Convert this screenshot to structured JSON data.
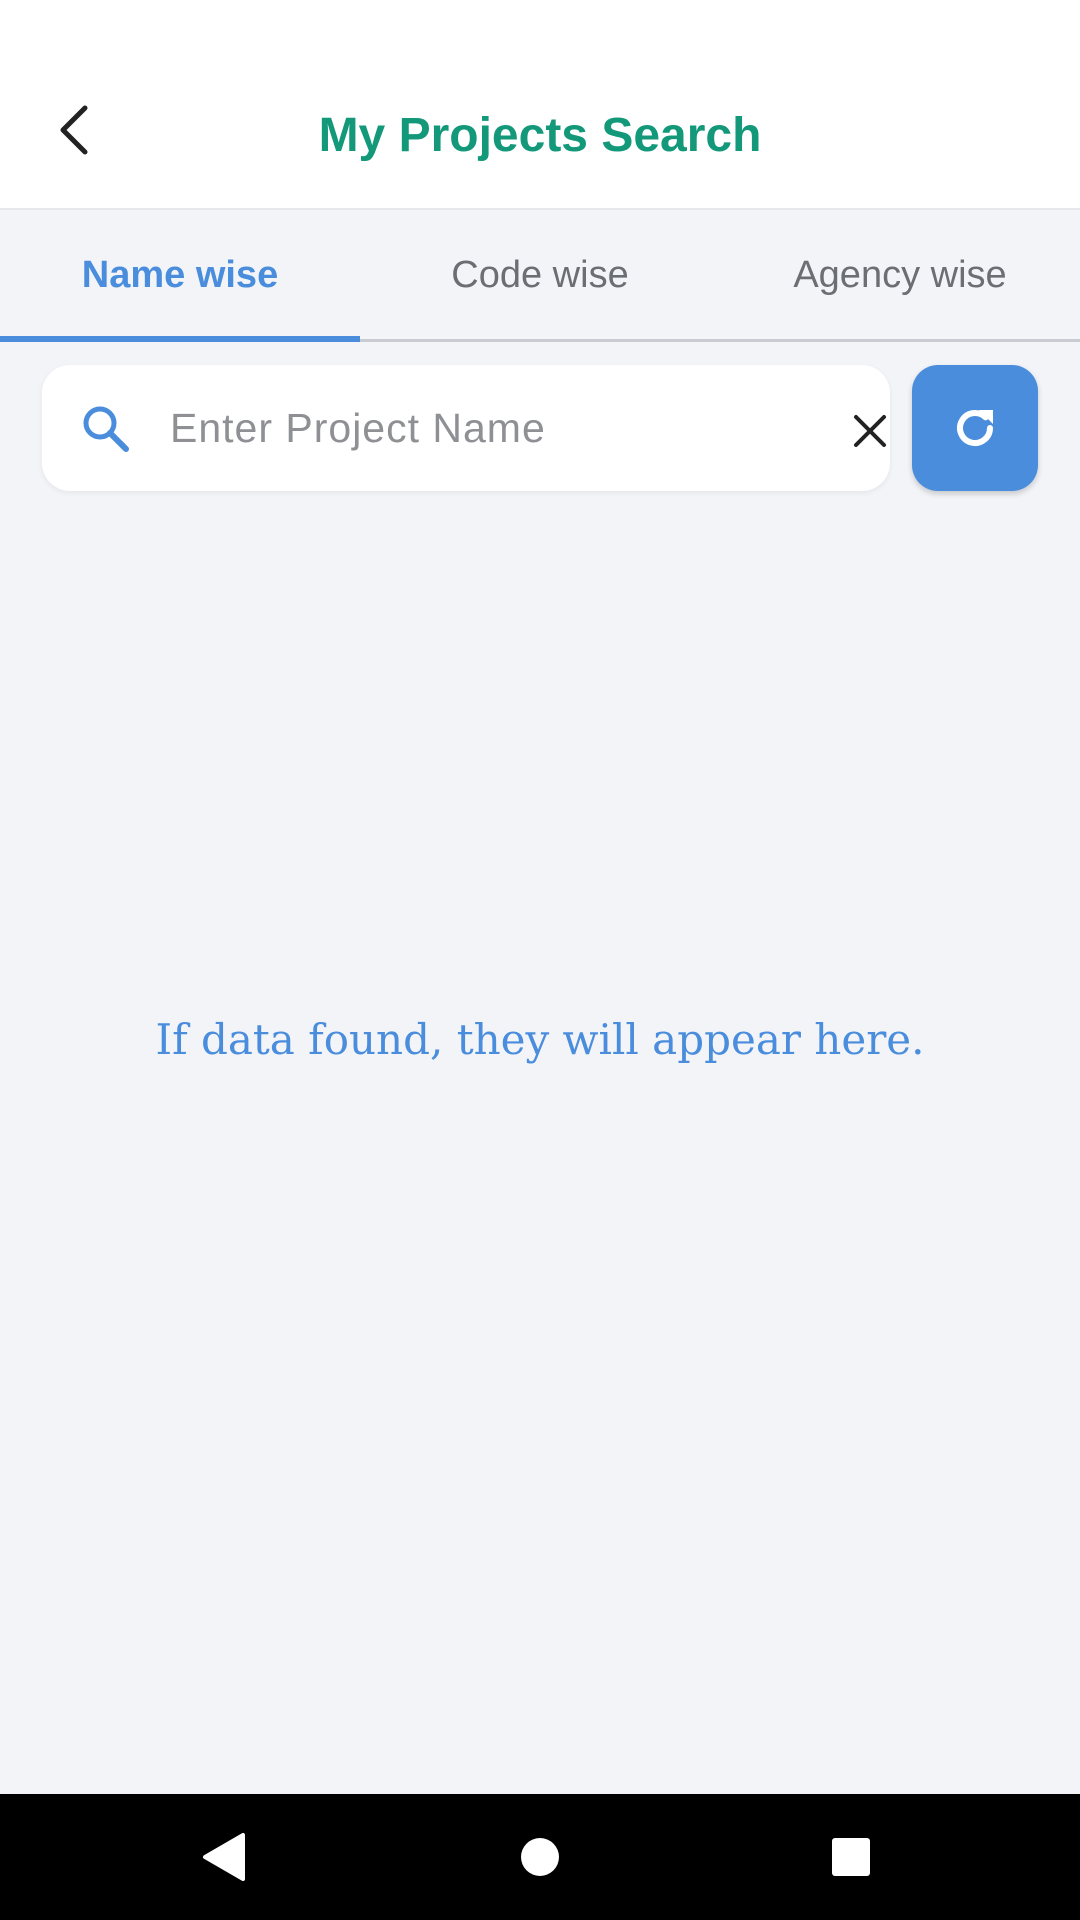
{
  "header": {
    "title": "My Projects Search",
    "back_icon": "chevron-left-icon"
  },
  "tabs": [
    {
      "label": "Name wise",
      "active": true
    },
    {
      "label": "Code wise",
      "active": false
    },
    {
      "label": "Agency wise",
      "active": false
    }
  ],
  "search": {
    "placeholder": "Enter Project Name",
    "value": "",
    "search_icon": "search-icon",
    "clear_icon": "close-icon"
  },
  "refresh": {
    "icon": "refresh-icon"
  },
  "empty_state": {
    "message": "If data found, they will appear here."
  },
  "colors": {
    "accent": "#4a8ddd",
    "title": "#13997a",
    "background": "#f2f4f8"
  }
}
